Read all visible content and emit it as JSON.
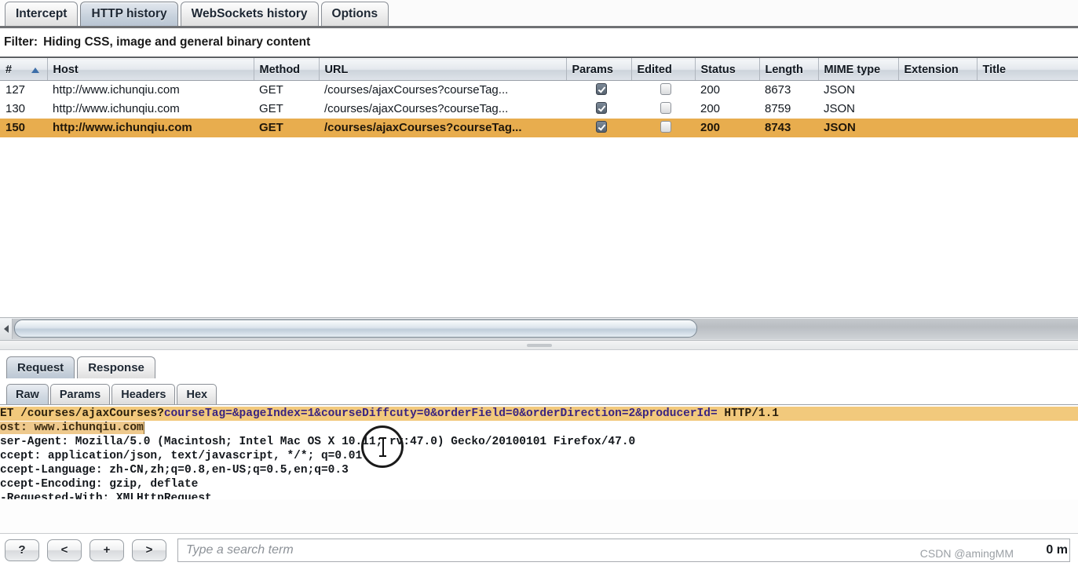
{
  "window": {
    "title": "Burp Suite - Proxy - HTTP history"
  },
  "top_tabs": [
    {
      "label": "Intercept",
      "selected": false
    },
    {
      "label": "HTTP history",
      "selected": true
    },
    {
      "label": "WebSockets history",
      "selected": false
    },
    {
      "label": "Options",
      "selected": false
    }
  ],
  "filter": {
    "label": "Filter:",
    "text": "Hiding CSS, image and general binary content"
  },
  "table": {
    "columns": [
      "#",
      "Host",
      "Method",
      "URL",
      "Params",
      "Edited",
      "Status",
      "Length",
      "MIME type",
      "Extension",
      "Title"
    ],
    "sort_column": "#",
    "sort_direction": "ascending",
    "sort_icon": "triangle-up-icon",
    "rows": [
      {
        "num": "127",
        "host": "http://www.ichunqiu.com",
        "method": "GET",
        "url": "/courses/ajaxCourses?courseTag...",
        "params": true,
        "edited": false,
        "status": "200",
        "length": "8673",
        "mime": "JSON",
        "extension": "",
        "title": "",
        "selected": false
      },
      {
        "num": "130",
        "host": "http://www.ichunqiu.com",
        "method": "GET",
        "url": "/courses/ajaxCourses?courseTag...",
        "params": true,
        "edited": false,
        "status": "200",
        "length": "8759",
        "mime": "JSON",
        "extension": "",
        "title": "",
        "selected": false
      },
      {
        "num": "150",
        "host": "http://www.ichunqiu.com",
        "method": "GET",
        "url": "/courses/ajaxCourses?courseTag...",
        "params": true,
        "edited": false,
        "status": "200",
        "length": "8743",
        "mime": "JSON",
        "extension": "",
        "title": "",
        "selected": true
      }
    ]
  },
  "hscrollbar": {
    "left_arrow_icon": "triangle-left-icon"
  },
  "lower_tabs": [
    {
      "label": "Request",
      "selected": true
    },
    {
      "label": "Response",
      "selected": false
    }
  ],
  "sub_tabs": [
    {
      "label": "Raw",
      "selected": true
    },
    {
      "label": "Params",
      "selected": false
    },
    {
      "label": "Headers",
      "selected": false
    },
    {
      "label": "Hex",
      "selected": false
    }
  ],
  "raw_request": {
    "line1_prefix": "ET /courses/ajaxCourses?",
    "line1_query": "courseTag=&pageIndex=1&courseDiffcuty=0&orderField=0&orderDirection=2&producerId=",
    "line1_suffix": " HTTP/1.1",
    "line2_highlight": "ost: www.ichunqiu.com",
    "line3": "ser-Agent: Mozilla/5.0 (Macintosh; Intel Mac OS X 10.11; rv:47.0) Gecko/20100101 Firefox/47.0",
    "line4": "ccept: application/json, text/javascript, */*; q=0.01",
    "line5": "ccept-Language: zh-CN,zh;q=0.8,en-US;q=0.5,en;q=0.3",
    "line6": "ccept-Encoding: gzip, deflate",
    "line7": "-Requested-With: XMLHttpRequest"
  },
  "bottom_toolbar": {
    "help_button": "?",
    "prev_button": "<",
    "add_button": "+",
    "next_button": ">",
    "search_placeholder": "Type a search term",
    "match_count": "0 m"
  },
  "watermark": "CSDN @amingMM",
  "colors": {
    "selection_row": "#e8ad4e",
    "highlight_text": "#f2c97c",
    "tab_selected": "#c9d3de",
    "sort_arrow": "#3d6ea8"
  }
}
